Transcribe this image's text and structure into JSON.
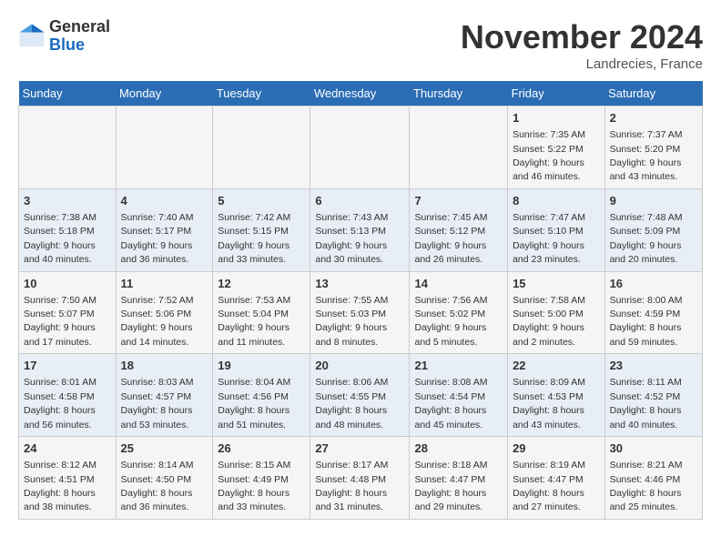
{
  "header": {
    "logo_general": "General",
    "logo_blue": "Blue",
    "title": "November 2024",
    "location": "Landrecies, France"
  },
  "days_of_week": [
    "Sunday",
    "Monday",
    "Tuesday",
    "Wednesday",
    "Thursday",
    "Friday",
    "Saturday"
  ],
  "weeks": [
    [
      {
        "day": "",
        "info": ""
      },
      {
        "day": "",
        "info": ""
      },
      {
        "day": "",
        "info": ""
      },
      {
        "day": "",
        "info": ""
      },
      {
        "day": "",
        "info": ""
      },
      {
        "day": "1",
        "info": "Sunrise: 7:35 AM\nSunset: 5:22 PM\nDaylight: 9 hours and 46 minutes."
      },
      {
        "day": "2",
        "info": "Sunrise: 7:37 AM\nSunset: 5:20 PM\nDaylight: 9 hours and 43 minutes."
      }
    ],
    [
      {
        "day": "3",
        "info": "Sunrise: 7:38 AM\nSunset: 5:18 PM\nDaylight: 9 hours and 40 minutes."
      },
      {
        "day": "4",
        "info": "Sunrise: 7:40 AM\nSunset: 5:17 PM\nDaylight: 9 hours and 36 minutes."
      },
      {
        "day": "5",
        "info": "Sunrise: 7:42 AM\nSunset: 5:15 PM\nDaylight: 9 hours and 33 minutes."
      },
      {
        "day": "6",
        "info": "Sunrise: 7:43 AM\nSunset: 5:13 PM\nDaylight: 9 hours and 30 minutes."
      },
      {
        "day": "7",
        "info": "Sunrise: 7:45 AM\nSunset: 5:12 PM\nDaylight: 9 hours and 26 minutes."
      },
      {
        "day": "8",
        "info": "Sunrise: 7:47 AM\nSunset: 5:10 PM\nDaylight: 9 hours and 23 minutes."
      },
      {
        "day": "9",
        "info": "Sunrise: 7:48 AM\nSunset: 5:09 PM\nDaylight: 9 hours and 20 minutes."
      }
    ],
    [
      {
        "day": "10",
        "info": "Sunrise: 7:50 AM\nSunset: 5:07 PM\nDaylight: 9 hours and 17 minutes."
      },
      {
        "day": "11",
        "info": "Sunrise: 7:52 AM\nSunset: 5:06 PM\nDaylight: 9 hours and 14 minutes."
      },
      {
        "day": "12",
        "info": "Sunrise: 7:53 AM\nSunset: 5:04 PM\nDaylight: 9 hours and 11 minutes."
      },
      {
        "day": "13",
        "info": "Sunrise: 7:55 AM\nSunset: 5:03 PM\nDaylight: 9 hours and 8 minutes."
      },
      {
        "day": "14",
        "info": "Sunrise: 7:56 AM\nSunset: 5:02 PM\nDaylight: 9 hours and 5 minutes."
      },
      {
        "day": "15",
        "info": "Sunrise: 7:58 AM\nSunset: 5:00 PM\nDaylight: 9 hours and 2 minutes."
      },
      {
        "day": "16",
        "info": "Sunrise: 8:00 AM\nSunset: 4:59 PM\nDaylight: 8 hours and 59 minutes."
      }
    ],
    [
      {
        "day": "17",
        "info": "Sunrise: 8:01 AM\nSunset: 4:58 PM\nDaylight: 8 hours and 56 minutes."
      },
      {
        "day": "18",
        "info": "Sunrise: 8:03 AM\nSunset: 4:57 PM\nDaylight: 8 hours and 53 minutes."
      },
      {
        "day": "19",
        "info": "Sunrise: 8:04 AM\nSunset: 4:56 PM\nDaylight: 8 hours and 51 minutes."
      },
      {
        "day": "20",
        "info": "Sunrise: 8:06 AM\nSunset: 4:55 PM\nDaylight: 8 hours and 48 minutes."
      },
      {
        "day": "21",
        "info": "Sunrise: 8:08 AM\nSunset: 4:54 PM\nDaylight: 8 hours and 45 minutes."
      },
      {
        "day": "22",
        "info": "Sunrise: 8:09 AM\nSunset: 4:53 PM\nDaylight: 8 hours and 43 minutes."
      },
      {
        "day": "23",
        "info": "Sunrise: 8:11 AM\nSunset: 4:52 PM\nDaylight: 8 hours and 40 minutes."
      }
    ],
    [
      {
        "day": "24",
        "info": "Sunrise: 8:12 AM\nSunset: 4:51 PM\nDaylight: 8 hours and 38 minutes."
      },
      {
        "day": "25",
        "info": "Sunrise: 8:14 AM\nSunset: 4:50 PM\nDaylight: 8 hours and 36 minutes."
      },
      {
        "day": "26",
        "info": "Sunrise: 8:15 AM\nSunset: 4:49 PM\nDaylight: 8 hours and 33 minutes."
      },
      {
        "day": "27",
        "info": "Sunrise: 8:17 AM\nSunset: 4:48 PM\nDaylight: 8 hours and 31 minutes."
      },
      {
        "day": "28",
        "info": "Sunrise: 8:18 AM\nSunset: 4:47 PM\nDaylight: 8 hours and 29 minutes."
      },
      {
        "day": "29",
        "info": "Sunrise: 8:19 AM\nSunset: 4:47 PM\nDaylight: 8 hours and 27 minutes."
      },
      {
        "day": "30",
        "info": "Sunrise: 8:21 AM\nSunset: 4:46 PM\nDaylight: 8 hours and 25 minutes."
      }
    ]
  ]
}
